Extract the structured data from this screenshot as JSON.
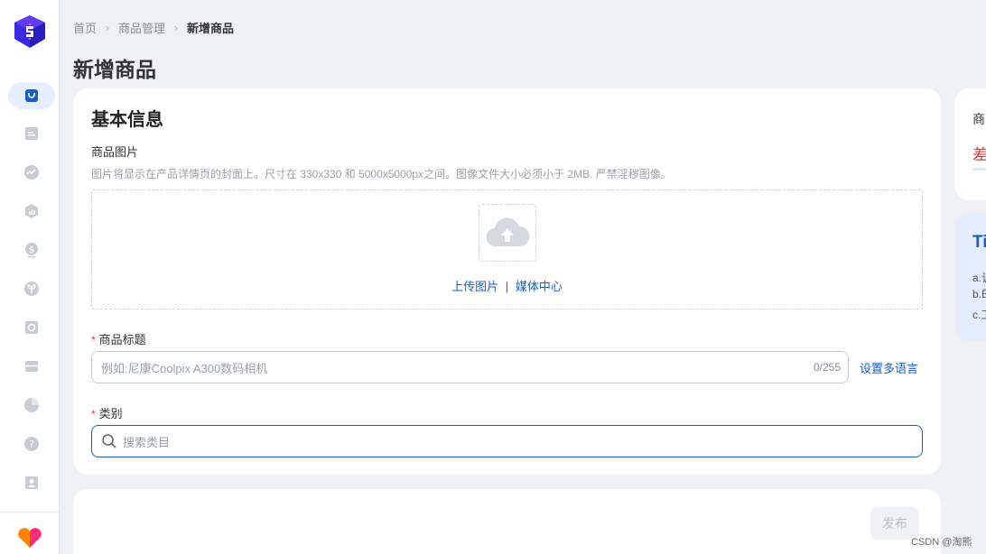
{
  "sidebar": {
    "icons": [
      "shop-bag-icon",
      "product-list-icon",
      "trend-icon",
      "analytics-icon",
      "finance-icon",
      "growth-icon",
      "promotion-icon",
      "store-icon",
      "report-icon",
      "help-icon",
      "account-icon"
    ]
  },
  "breadcrumb": {
    "home": "首页",
    "product_management": "商品管理",
    "current": "新增商品"
  },
  "page_title": "新增商品",
  "basic_info": {
    "title": "基本信息",
    "image_label": "商品图片",
    "image_hint": "图片将显示在产品详情页的封面上。尺寸在 330x330 和 5000x5000px之间。图像文件大小必须小于 2MB. 严禁淫秽图像。",
    "upload_link": "上传图片",
    "upload_separator": "|",
    "media_center_link": "媒体中心",
    "required_mark": "*",
    "product_title_label": "商品标题",
    "product_title_placeholder": "例如:尼康Coolpix A300数码相机",
    "product_title_count": "0/255",
    "multi_language_link": "设置多语言",
    "category_label": "类别",
    "category_search_placeholder": "搜索类目"
  },
  "actions": {
    "publish": "发布"
  },
  "right_panel": {
    "card1_text": "商",
    "card1_status": "差",
    "tips_title": "Ti",
    "tips_a": "a.该",
    "tips_b": "b.Ë",
    "tips_c": "c.工"
  },
  "watermark": "CSDN @淘熊",
  "colors": {
    "accent": "#1a5cc8",
    "required": "#e53935",
    "background": "#eff0f4"
  }
}
